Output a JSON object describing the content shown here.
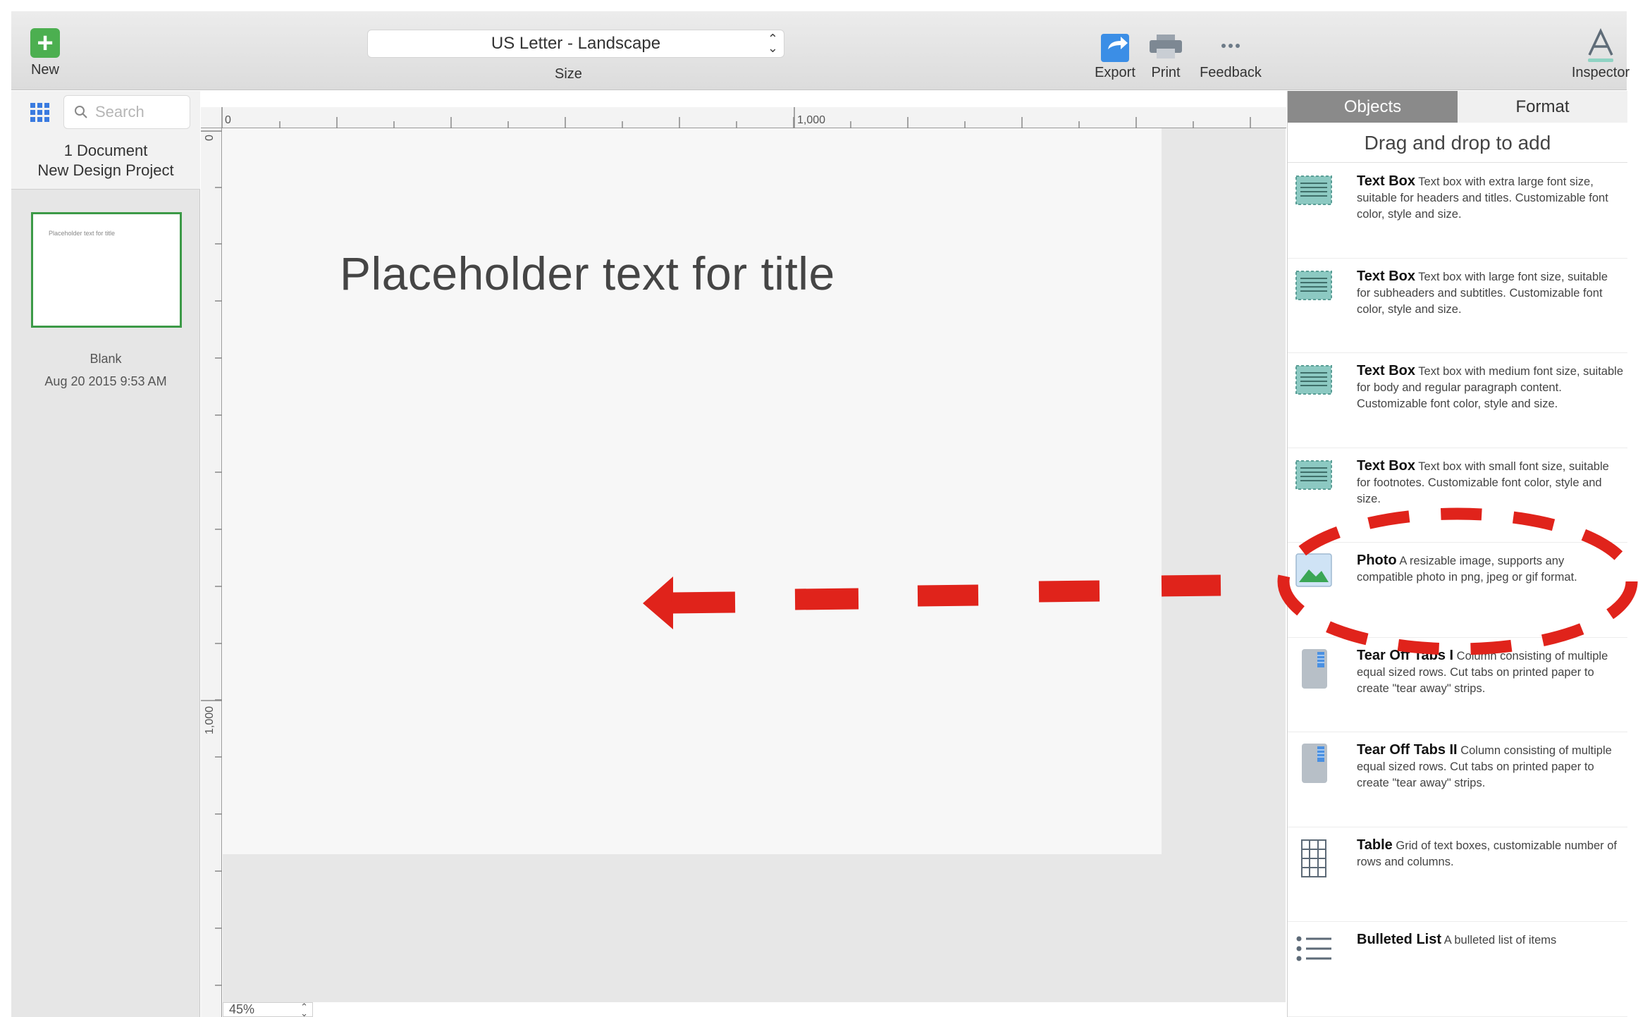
{
  "toolbar": {
    "new_label": "New",
    "size_value": "US Letter - Landscape",
    "size_label": "Size",
    "export_label": "Export",
    "print_label": "Print",
    "feedback_label": "Feedback",
    "inspector_label": "Inspector"
  },
  "sidebar": {
    "search_placeholder": "Search",
    "doc_count": "1 Document",
    "project_name": "New Design Project",
    "thumbnail": {
      "preview_text": "Placeholder text for title",
      "name": "Blank",
      "date": "Aug 20 2015 9:53 AM"
    }
  },
  "rulers": {
    "top_ticks": [
      "0",
      "1,000"
    ],
    "left_ticks": [
      "0",
      "1,000"
    ]
  },
  "canvas": {
    "title_text": "Placeholder text for title",
    "zoom": "45%"
  },
  "panel": {
    "tabs": [
      {
        "label": "Objects",
        "active": true
      },
      {
        "label": "Format",
        "active": false
      }
    ],
    "hint": "Drag and drop to add",
    "objects": [
      {
        "name": "Text Box",
        "desc": "Text box with extra large font size, suitable for headers and titles. Customizable font color, style and size.",
        "icon": "textbox-icon"
      },
      {
        "name": "Text Box",
        "desc": "Text box with large font size, suitable for subheaders and subtitles. Customizable font color, style and size.",
        "icon": "textbox-icon"
      },
      {
        "name": "Text Box",
        "desc": "Text box with medium font size, suitable for body and regular paragraph content. Customizable font color, style and size.",
        "icon": "textbox-icon"
      },
      {
        "name": "Text Box",
        "desc": "Text box with small font size, suitable for footnotes. Customizable font color, style and size.",
        "icon": "textbox-icon"
      },
      {
        "name": "Photo",
        "desc": "A resizable image, supports any compatible photo in png, jpeg or gif format.",
        "icon": "photo-icon"
      },
      {
        "name": "Tear Off Tabs I",
        "desc": "Column consisting of multiple equal sized rows.  Cut tabs on printed paper to create \"tear away\" strips.",
        "icon": "tear-off-tabs-icon"
      },
      {
        "name": "Tear Off Tabs II",
        "desc": "Column consisting of multiple equal sized rows.  Cut tabs on printed paper to create \"tear away\" strips.",
        "icon": "tear-off-tabs-icon"
      },
      {
        "name": "Table",
        "desc": "Grid of text boxes, customizable number of rows and columns.",
        "icon": "table-icon"
      },
      {
        "name": "Bulleted List",
        "desc": "A bulleted list of items",
        "icon": "bulleted-list-icon"
      }
    ]
  },
  "colors": {
    "accent_green": "#4caf50",
    "active_tab": "#8a8a8a",
    "annotation_red": "#e0231b",
    "export_blue": "#3b8ee6"
  }
}
